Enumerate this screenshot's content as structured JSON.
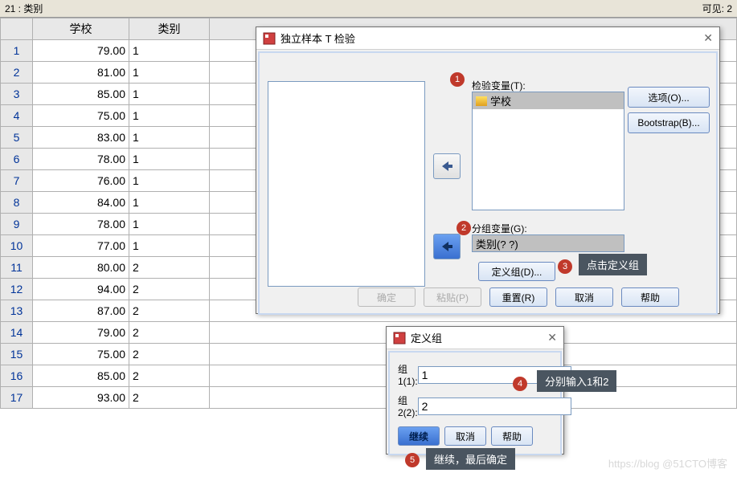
{
  "info_bar": {
    "left": "21 : 类别",
    "right": "可见: 2"
  },
  "columns": {
    "row": "",
    "school": "学校",
    "category": "类别"
  },
  "rows": [
    {
      "n": "1",
      "school": "79.00",
      "cat": "1"
    },
    {
      "n": "2",
      "school": "81.00",
      "cat": "1"
    },
    {
      "n": "3",
      "school": "85.00",
      "cat": "1"
    },
    {
      "n": "4",
      "school": "75.00",
      "cat": "1"
    },
    {
      "n": "5",
      "school": "83.00",
      "cat": "1"
    },
    {
      "n": "6",
      "school": "78.00",
      "cat": "1"
    },
    {
      "n": "7",
      "school": "76.00",
      "cat": "1"
    },
    {
      "n": "8",
      "school": "84.00",
      "cat": "1"
    },
    {
      "n": "9",
      "school": "78.00",
      "cat": "1"
    },
    {
      "n": "10",
      "school": "77.00",
      "cat": "1"
    },
    {
      "n": "11",
      "school": "80.00",
      "cat": "2"
    },
    {
      "n": "12",
      "school": "94.00",
      "cat": "2"
    },
    {
      "n": "13",
      "school": "87.00",
      "cat": "2"
    },
    {
      "n": "14",
      "school": "79.00",
      "cat": "2"
    },
    {
      "n": "15",
      "school": "75.00",
      "cat": "2"
    },
    {
      "n": "16",
      "school": "85.00",
      "cat": "2"
    },
    {
      "n": "17",
      "school": "93.00",
      "cat": "2"
    }
  ],
  "dialog1": {
    "title": "独立样本 T 检验",
    "test_var_label": "检验变量(T):",
    "test_var_item": "学校",
    "group_var_label": "分组变量(G):",
    "group_var_value": "类别(? ?)",
    "define_groups_btn": "定义组(D)...",
    "options_btn": "选项(O)...",
    "bootstrap_btn": "Bootstrap(B)...",
    "ok": "确定",
    "paste": "粘贴(P)",
    "reset": "重置(R)",
    "cancel": "取消",
    "help": "帮助"
  },
  "dialog2": {
    "title": "定义组",
    "g1_label": "组 1(1):",
    "g2_label": "组 2(2):",
    "g1_value": "1",
    "g2_value": "2",
    "continue": "继续",
    "cancel": "取消",
    "help": "帮助"
  },
  "badges": {
    "b1": "1",
    "b2": "2",
    "b3": "3",
    "b4": "4",
    "b5": "5"
  },
  "tips": {
    "t3": "点击定义组",
    "t4": "分别输入1和2",
    "t5": "继续，最后确定"
  },
  "watermark": "https://blog @51CTO博客"
}
